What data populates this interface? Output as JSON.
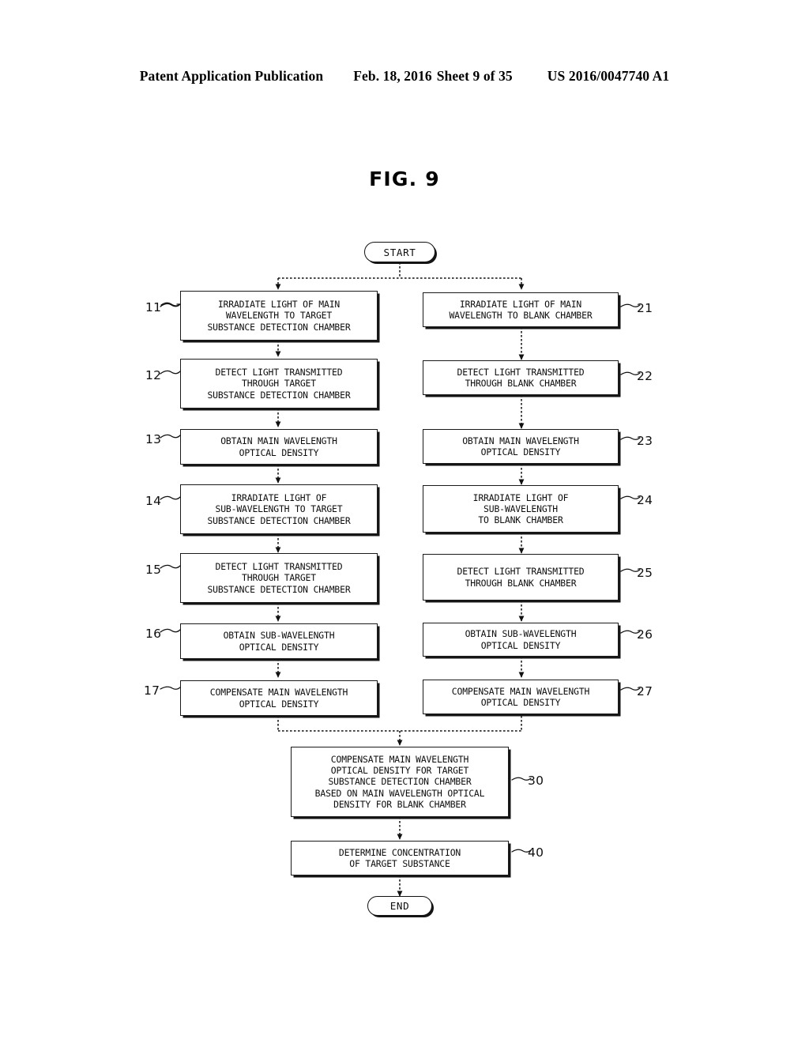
{
  "header": {
    "publication": "Patent Application Publication",
    "date": "Feb. 18, 2016",
    "sheet": "Sheet 9 of 35",
    "patent_number": "US 2016/0047740 A1"
  },
  "figure": {
    "title": "FIG. 9"
  },
  "terminals": {
    "start": "START",
    "end": "END"
  },
  "nodes": {
    "n11": {
      "ref": "11",
      "text": "IRRADIATE LIGHT OF MAIN\nWAVELENGTH TO TARGET\nSUBSTANCE DETECTION CHAMBER"
    },
    "n12": {
      "ref": "12",
      "text": "DETECT LIGHT TRANSMITTED\nTHROUGH TARGET\nSUBSTANCE DETECTION CHAMBER"
    },
    "n13": {
      "ref": "13",
      "text": "OBTAIN MAIN WAVELENGTH\nOPTICAL DENSITY"
    },
    "n14": {
      "ref": "14",
      "text": "IRRADIATE LIGHT OF\nSUB-WAVELENGTH TO TARGET\nSUBSTANCE DETECTION CHAMBER"
    },
    "n15": {
      "ref": "15",
      "text": "DETECT LIGHT TRANSMITTED\nTHROUGH TARGET\nSUBSTANCE DETECTION CHAMBER"
    },
    "n16": {
      "ref": "16",
      "text": "OBTAIN SUB-WAVELENGTH\nOPTICAL DENSITY"
    },
    "n17": {
      "ref": "17",
      "text": "COMPENSATE MAIN WAVELENGTH\nOPTICAL DENSITY"
    },
    "n21": {
      "ref": "21",
      "text": "IRRADIATE LIGHT OF MAIN\nWAVELENGTH TO BLANK CHAMBER"
    },
    "n22": {
      "ref": "22",
      "text": "DETECT LIGHT TRANSMITTED\nTHROUGH BLANK CHAMBER"
    },
    "n23": {
      "ref": "23",
      "text": "OBTAIN MAIN WAVELENGTH\nOPTICAL DENSITY"
    },
    "n24": {
      "ref": "24",
      "text": "IRRADIATE LIGHT OF\nSUB-WAVELENGTH\nTO BLANK CHAMBER"
    },
    "n25": {
      "ref": "25",
      "text": "DETECT LIGHT TRANSMITTED\nTHROUGH BLANK CHAMBER"
    },
    "n26": {
      "ref": "26",
      "text": "OBTAIN SUB-WAVELENGTH\nOPTICAL DENSITY"
    },
    "n27": {
      "ref": "27",
      "text": "COMPENSATE MAIN WAVELENGTH\nOPTICAL DENSITY"
    },
    "n30": {
      "ref": "30",
      "text": "COMPENSATE MAIN WAVELENGTH\nOPTICAL DENSITY FOR TARGET\nSUBSTANCE DETECTION CHAMBER\nBASED ON MAIN WAVELENGTH OPTICAL\nDENSITY FOR BLANK CHAMBER"
    },
    "n40": {
      "ref": "40",
      "text": "DETERMINE CONCENTRATION\nOF TARGET SUBSTANCE"
    }
  },
  "colors": {
    "line": "#1a1a1a",
    "text": "#0d0d0d",
    "background": "#ffffff"
  }
}
